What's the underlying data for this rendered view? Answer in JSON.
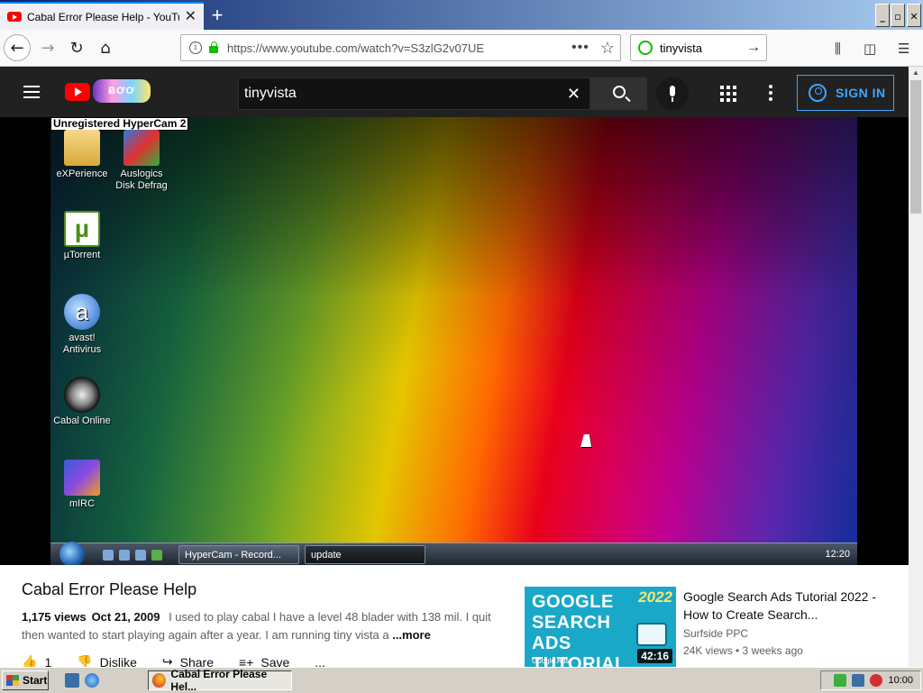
{
  "browser": {
    "tab_title": "Cabal Error Please Help - YouTube",
    "tab_close": "✕",
    "new_tab": "+",
    "url": "https://www.youtube.com/watch?v=S3zlG2v07UE",
    "url_menu": "•••",
    "search_text": "tinyvista",
    "window_controls": [
      "_",
      "▫",
      "✕"
    ]
  },
  "youtube": {
    "search_query": "tinyvista",
    "signin_label": "SIGN IN",
    "doodle_text": "ɃƠƠ"
  },
  "video_frame": {
    "watermark": "Unregistered HyperCam 2",
    "desktop_icons": [
      {
        "label": "eXPerience",
        "icon": "folder-icon"
      },
      {
        "label": "Auslogics Disk Defrag",
        "icon": "defrag-icon"
      },
      {
        "label": "µTorrent",
        "icon": "utorrent-icon"
      },
      {
        "label": "avast! Antivirus",
        "icon": "avast-icon"
      },
      {
        "label": "Cabal Online",
        "icon": "cabal-icon"
      },
      {
        "label": "mIRC",
        "icon": "mirc-icon"
      }
    ],
    "taskbar_buttons": [
      "HyperCam - Record...",
      "update"
    ],
    "clock": "12:20"
  },
  "video": {
    "title": "Cabal Error Please Help",
    "views": "1,175 views",
    "date": "Oct 21, 2009",
    "description": "I used to play cabal I have a level 48 blader with 138 mil. I quit then wanted to start playing again after a year. I am running tiny vista a",
    "more_label": "...more",
    "actions": {
      "like_count": "1",
      "dislike": "Dislike",
      "share": "Share",
      "save": "Save",
      "more": "..."
    }
  },
  "recommended": [
    {
      "thumb_text": "GOOGLE SEARCH ADS TUTORIAL",
      "thumb_year": "2022",
      "thumb_badge": "Google Ads",
      "duration": "42:16",
      "title": "Google Search Ads Tutorial 2022 - How to Create Search...",
      "channel": "Surfside PPC",
      "meta": "24K views • 3 weeks ago"
    }
  ],
  "os_taskbar": {
    "start_label": "Start",
    "task_label": "Cabal Error Please Hel...",
    "clock": "10:00"
  }
}
